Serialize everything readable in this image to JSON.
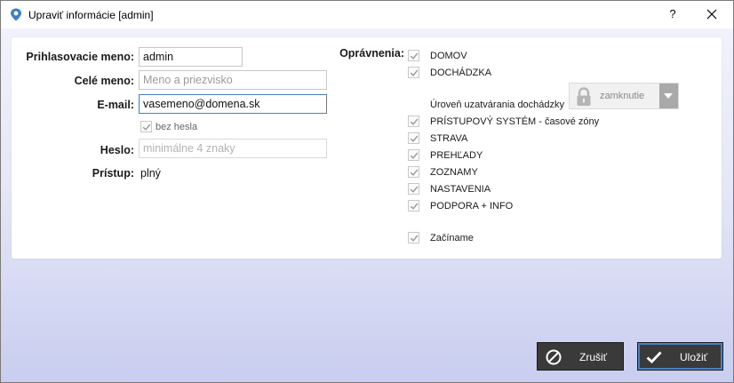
{
  "window": {
    "title": "Upraviť informácie [admin]",
    "help_label": "?"
  },
  "form": {
    "username": {
      "label": "Prihlasovacie meno:",
      "value": "admin"
    },
    "fullname": {
      "label": "Celé meno:",
      "placeholder": "Meno a priezvisko"
    },
    "email": {
      "label": "E-mail:",
      "value": "vasemeno@domena.sk"
    },
    "no_password": {
      "label": "bez hesla",
      "checked": true
    },
    "password": {
      "label": "Heslo:",
      "placeholder": "minimálne 4 znaky"
    },
    "access": {
      "label": "Prístup:",
      "value": "plný"
    }
  },
  "permissions": {
    "label": "Oprávnenia:",
    "items": [
      {
        "label": "DOMOV",
        "checked": true
      },
      {
        "label": "DOCHÁDZKA",
        "checked": true
      },
      {
        "label": "PRÍSTUPOVÝ SYSTÉM - časové zóny",
        "checked": true
      },
      {
        "label": "STRAVA",
        "checked": true
      },
      {
        "label": "PREHĽADY",
        "checked": true
      },
      {
        "label": "ZOZNAMY",
        "checked": true
      },
      {
        "label": "NASTAVENIA",
        "checked": true
      },
      {
        "label": "PODPORA + INFO",
        "checked": true
      }
    ],
    "attendance_level": {
      "label": "Úroveň uzatvárania dochádzky",
      "value": "zamknutie"
    },
    "getting_started": {
      "label": "Začíname",
      "checked": true
    }
  },
  "buttons": {
    "cancel": "Zrušiť",
    "save": "Uložiť"
  },
  "colors": {
    "accent_focus": "#4a7fc0",
    "button_bg": "#3a3a3a",
    "gradient_bottom": "#c9cdef"
  }
}
